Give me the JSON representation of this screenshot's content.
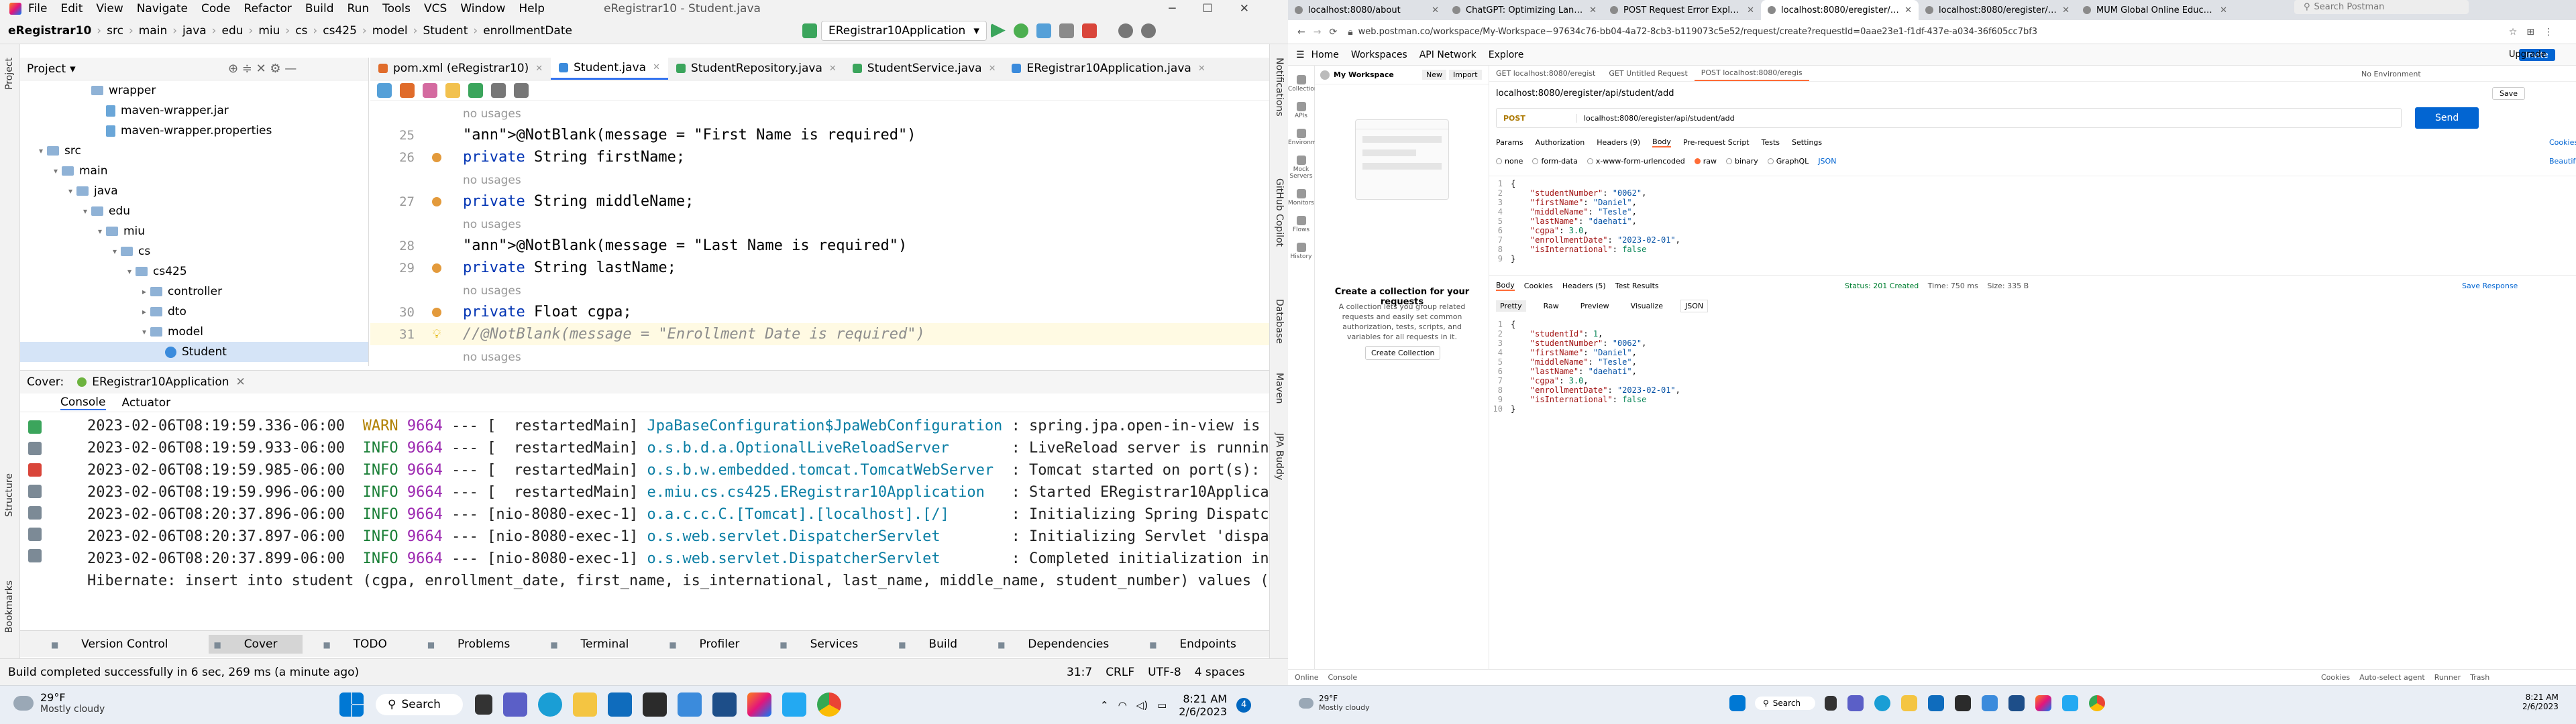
{
  "ij": {
    "title": "eRegistrar10 - Student.java",
    "menu": [
      "File",
      "Edit",
      "View",
      "Navigate",
      "Code",
      "Refactor",
      "Build",
      "Run",
      "Tools",
      "VCS",
      "Window",
      "Help"
    ],
    "breadcrumbs": [
      "eRegistrar10",
      "src",
      "main",
      "java",
      "edu",
      "miu",
      "cs",
      "cs425",
      "model",
      "Student",
      "enrollmentDate"
    ],
    "run_config": "ERegistrar10Application",
    "project_label": "Project",
    "tree": [
      {
        "label": "wrapper",
        "indent": 4,
        "type": "folder",
        "arrow": ""
      },
      {
        "label": "maven-wrapper.jar",
        "indent": 5,
        "type": "file",
        "arrow": ""
      },
      {
        "label": "maven-wrapper.properties",
        "indent": 5,
        "type": "file",
        "arrow": ""
      },
      {
        "label": "src",
        "indent": 1,
        "type": "folder",
        "arrow": "▾"
      },
      {
        "label": "main",
        "indent": 2,
        "type": "folder",
        "arrow": "▾"
      },
      {
        "label": "java",
        "indent": 3,
        "type": "folder",
        "arrow": "▾"
      },
      {
        "label": "edu",
        "indent": 4,
        "type": "folder",
        "arrow": "▾"
      },
      {
        "label": "miu",
        "indent": 5,
        "type": "folder",
        "arrow": "▾"
      },
      {
        "label": "cs",
        "indent": 6,
        "type": "folder",
        "arrow": "▾"
      },
      {
        "label": "cs425",
        "indent": 7,
        "type": "folder",
        "arrow": "▾"
      },
      {
        "label": "controller",
        "indent": 8,
        "type": "folder",
        "arrow": "▸"
      },
      {
        "label": "dto",
        "indent": 8,
        "type": "folder",
        "arrow": "▸"
      },
      {
        "label": "model",
        "indent": 8,
        "type": "folder",
        "arrow": "▾"
      },
      {
        "label": "Student",
        "indent": 9,
        "type": "class",
        "arrow": "",
        "selected": true
      }
    ],
    "tabs": [
      {
        "label": "pom.xml (eRegistrar10)",
        "color": "#e06c2b",
        "active": false
      },
      {
        "label": "Student.java",
        "color": "#3b8bdc",
        "active": true
      },
      {
        "label": "StudentRepository.java",
        "color": "#3ba55c",
        "active": false
      },
      {
        "label": "StudentService.java",
        "color": "#3ba55c",
        "active": false
      },
      {
        "label": "ERegistrar10Application.java",
        "color": "#3b8bdc",
        "active": false
      }
    ],
    "code": [
      {
        "ln": "",
        "text": "no usages",
        "kind": "usg"
      },
      {
        "ln": "25",
        "text": "@NotBlank(message = \"First Name is required\")",
        "kind": "ann"
      },
      {
        "ln": "26",
        "text": "private String firstName;",
        "kind": "decl",
        "dot": true
      },
      {
        "ln": "",
        "text": "no usages",
        "kind": "usg"
      },
      {
        "ln": "27",
        "text": "private String middleName;",
        "kind": "decl",
        "dot": true
      },
      {
        "ln": "",
        "text": "no usages",
        "kind": "usg"
      },
      {
        "ln": "28",
        "text": "@NotBlank(message = \"Last Name is required\")",
        "kind": "ann"
      },
      {
        "ln": "29",
        "text": "private String lastName;",
        "kind": "decl",
        "dot": true
      },
      {
        "ln": "",
        "text": "no usages",
        "kind": "usg"
      },
      {
        "ln": "30",
        "text": "private Float cgpa;",
        "kind": "decl",
        "dot": true
      },
      {
        "ln": "31",
        "text": "//@NotBlank(message = \"Enrollment Date is required\")",
        "kind": "cmt",
        "bulb": true
      },
      {
        "ln": "",
        "text": "no usages",
        "kind": "usg"
      }
    ],
    "run_head": "Cover:",
    "run_app": "ERegistrar10Application",
    "run_tabs": [
      "Console",
      "Actuator"
    ],
    "logs": [
      {
        "ts": "2023-02-06T08:19:59.336-06:00",
        "lvl": "WARN",
        "pid": "9664",
        "sep": "---",
        "thread": "[  restartedMain]",
        "logger": "JpaBaseConfiguration$JpaWebConfiguration",
        "msg": ": spring.jpa.open-in-view is en"
      },
      {
        "ts": "2023-02-06T08:19:59.933-06:00",
        "lvl": "INFO",
        "pid": "9664",
        "sep": "---",
        "thread": "[  restartedMain]",
        "logger": "o.s.b.d.a.OptionalLiveReloadServer      ",
        "msg": ": LiveReload server is running"
      },
      {
        "ts": "2023-02-06T08:19:59.985-06:00",
        "lvl": "INFO",
        "pid": "9664",
        "sep": "---",
        "thread": "[  restartedMain]",
        "logger": "o.s.b.w.embedded.tomcat.TomcatWebServer ",
        "msg": ": Tomcat started on port(s): 80"
      },
      {
        "ts": "2023-02-06T08:19:59.996-06:00",
        "lvl": "INFO",
        "pid": "9664",
        "sep": "---",
        "thread": "[  restartedMain]",
        "logger": "e.miu.cs.cs425.ERegistrar10Application  ",
        "msg": ": Started ERegistrar10Applicati"
      },
      {
        "ts": "2023-02-06T08:20:37.896-06:00",
        "lvl": "INFO",
        "pid": "9664",
        "sep": "---",
        "thread": "[nio-8080-exec-1]",
        "logger": "o.a.c.c.C.[Tomcat].[localhost].[/]      ",
        "msg": ": Initializing Spring Dispatche"
      },
      {
        "ts": "2023-02-06T08:20:37.897-06:00",
        "lvl": "INFO",
        "pid": "9664",
        "sep": "---",
        "thread": "[nio-8080-exec-1]",
        "logger": "o.s.web.servlet.DispatcherServlet       ",
        "msg": ": Initializing Servlet 'dispatc"
      },
      {
        "ts": "2023-02-06T08:20:37.899-06:00",
        "lvl": "INFO",
        "pid": "9664",
        "sep": "---",
        "thread": "[nio-8080-exec-1]",
        "logger": "o.s.web.servlet.DispatcherServlet       ",
        "msg": ": Completed initialization in 1"
      }
    ],
    "hibernate": "Hibernate: insert into student (cgpa, enrollment_date, first_name, is_international, last_name, middle_name, student_number) values (?,",
    "toolwindows": [
      "Version Control",
      "Cover",
      "TODO",
      "Problems",
      "Terminal",
      "Profiler",
      "Services",
      "Build",
      "Dependencies",
      "Endpoints"
    ],
    "status": "Build completed successfully in 6 sec, 269 ms (a minute ago)",
    "status_right": [
      "31:7",
      "CRLF",
      "UTF-8",
      "4 spaces"
    ],
    "left_strip": [
      "Project",
      "Structure",
      "Bookmarks"
    ],
    "right_strip": [
      "Notifications",
      "GitHub Copilot",
      "Database",
      "Maven",
      "JPA Buddy"
    ]
  },
  "chrome": {
    "tabs": [
      "localhost:8080/about",
      "ChatGPT: Optimizing Language",
      "POST Request Error Explanation",
      "localhost:8080/eregister/api/stu...",
      "localhost:8080/eregister/api/stu...",
      "MUM Global Online Education"
    ],
    "active_tab": 3,
    "url": "web.postman.co/workspace/My-Workspace~97634c76-bb04-4a72-8cb3-b119073c5e52/request/create?requestId=0aae23e1-f1df-437e-a034-36f605cc7bf3"
  },
  "postman": {
    "top_nav": [
      "Home",
      "Workspaces",
      "API Network",
      "Explore"
    ],
    "search": "Search Postman",
    "invite": "Invite",
    "upgrade": "Upgrade",
    "workspace": "My Workspace",
    "new_btn": "New",
    "import_btn": "Import",
    "side_items": [
      "Collections",
      "APIs",
      "Environments",
      "Mock Servers",
      "Monitors",
      "Flows",
      "History"
    ],
    "req_tabs": [
      "GET localhost:8080/eregist",
      "GET Untitled Request",
      "POST localhost:8080/eregis"
    ],
    "env": "No Environment",
    "req_title": "localhost:8080/eregister/api/student/add",
    "save": "Save",
    "method": "POST",
    "req_url": "localhost:8080/eregister/api/student/add",
    "send": "Send",
    "param_tabs": [
      "Params",
      "Authorization",
      "Headers (9)",
      "Body",
      "Pre-request Script",
      "Tests",
      "Settings"
    ],
    "cookies": "Cookies",
    "body_types": [
      "none",
      "form-data",
      "x-www-form-urlencoded",
      "raw",
      "binary",
      "GraphQL",
      "JSON"
    ],
    "beautify": "Beautify",
    "collection_title": "Create a collection for your requests",
    "collection_desc": "A collection lets you group related requests and easily set common authorization, tests, scripts, and variables for all requests in it.",
    "collection_btn": "Create Collection",
    "req_body": [
      "{",
      "    \"studentNumber\": \"0062\",",
      "    \"firstName\": \"Daniel\",",
      "    \"middleName\": \"Tesle\",",
      "    \"lastName\": \"daehati\",",
      "    \"cgpa\": 3.0,",
      "    \"enrollmentDate\": \"2023-02-01\",",
      "    \"isInternational\": false",
      "}"
    ],
    "resp_tabs": [
      "Body",
      "Cookies",
      "Headers (5)",
      "Test Results"
    ],
    "resp_status": "Status: 201 Created",
    "resp_time": "Time: 750 ms",
    "resp_size": "Size: 335 B",
    "save_response": "Save Response",
    "resp_views": [
      "Pretty",
      "Raw",
      "Preview",
      "Visualize",
      "JSON"
    ],
    "resp_body": [
      "{",
      "    \"studentId\": 1,",
      "    \"studentNumber\": \"0062\",",
      "    \"firstName\": \"Daniel\",",
      "    \"middleName\": \"Tesle\",",
      "    \"lastName\": \"daehati\",",
      "    \"cgpa\": 3.0,",
      "    \"enrollmentDate\": \"2023-02-01\",",
      "    \"isInternational\": false",
      "}"
    ],
    "footer_left": [
      "Online",
      "Console"
    ],
    "footer_right": [
      "Cookies",
      "Auto-select agent",
      "Runner",
      "Trash"
    ]
  },
  "taskbar_left": {
    "weather_temp": "29°F",
    "weather_desc": "Mostly cloudy",
    "search": "Search",
    "time": "8:21 AM",
    "date": "2/6/2023",
    "badge": "4"
  },
  "taskbar_right": {
    "weather_temp": "29°F",
    "weather_desc": "Mostly cloudy",
    "search": "Search",
    "time": "8:21 AM",
    "date": "2/6/2023"
  }
}
